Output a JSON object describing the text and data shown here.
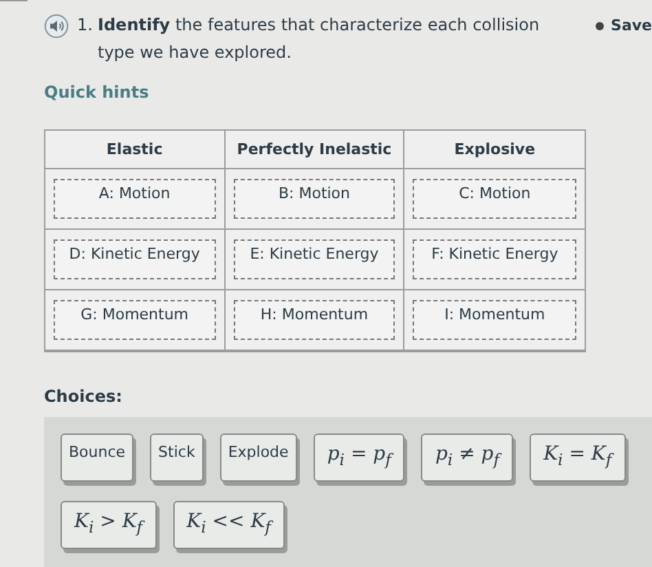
{
  "question": {
    "number": "1.",
    "text": "**Identify** the features that characterize each collision type we have explored."
  },
  "status": {
    "label": "Save"
  },
  "hints_link": "Quick hints",
  "table": {
    "columns": [
      "Elastic",
      "Perfectly Inelastic",
      "Explosive"
    ],
    "rows": [
      [
        "A: Motion",
        "B: Motion",
        "C: Motion"
      ],
      [
        "D: Kinetic Energy",
        "E: Kinetic Energy",
        "F: Kinetic Energy"
      ],
      [
        "G: Momentum",
        "H: Momentum",
        "I: Momentum"
      ]
    ]
  },
  "choices_label": "Choices:",
  "choices": [
    {
      "kind": "text",
      "label": "Bounce"
    },
    {
      "kind": "text",
      "label": "Stick"
    },
    {
      "kind": "text",
      "label": "Explode"
    },
    {
      "kind": "math",
      "label": "p$_{i}$ = p$_{f}$"
    },
    {
      "kind": "math",
      "label": "p$_{i}$ ≠ p$_{f}$"
    },
    {
      "kind": "math",
      "label": "K$_{i}$ = K$_{f}$"
    },
    {
      "kind": "math",
      "label": "K$_{i}$ > K$_{f}$"
    },
    {
      "kind": "math",
      "label": "K$_{i}$ << K$_{f}$"
    }
  ]
}
